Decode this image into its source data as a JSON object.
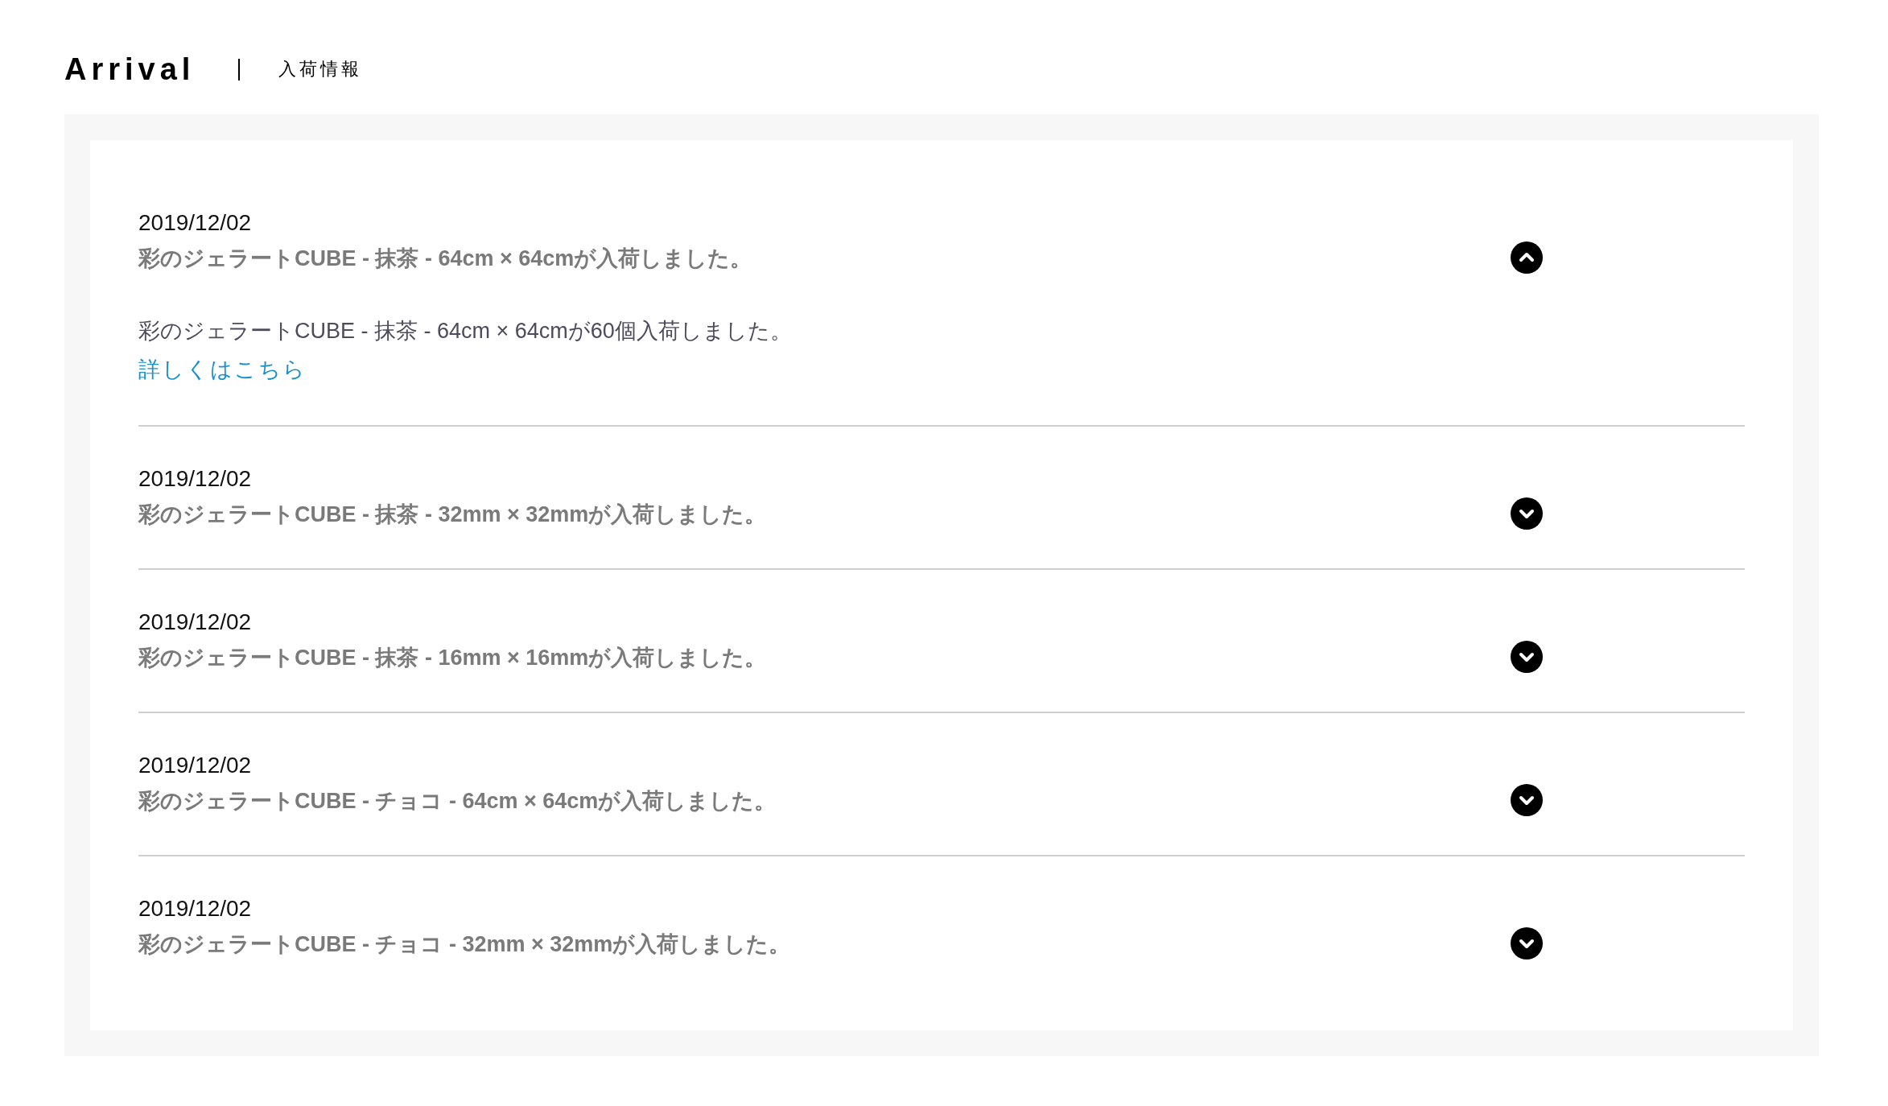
{
  "header": {
    "title": "Arrival",
    "subtitle": "入荷情報"
  },
  "items": [
    {
      "date": "2019/12/02",
      "title": "彩のジェラートCUBE - 抹茶 - 64cm × 64cmが入荷しました。",
      "expanded": true,
      "body": "彩のジェラートCUBE - 抹茶 - 64cm × 64cmが60個入荷しました。",
      "link": "詳しくはこちら"
    },
    {
      "date": "2019/12/02",
      "title": "彩のジェラートCUBE - 抹茶 - 32mm × 32mmが入荷しました。",
      "expanded": false
    },
    {
      "date": "2019/12/02",
      "title": "彩のジェラートCUBE - 抹茶 - 16mm × 16mmが入荷しました。",
      "expanded": false
    },
    {
      "date": "2019/12/02",
      "title": "彩のジェラートCUBE - チョコ - 64cm × 64cmが入荷しました。",
      "expanded": false
    },
    {
      "date": "2019/12/02",
      "title": "彩のジェラートCUBE - チョコ - 32mm × 32mmが入荷しました。",
      "expanded": false
    }
  ]
}
